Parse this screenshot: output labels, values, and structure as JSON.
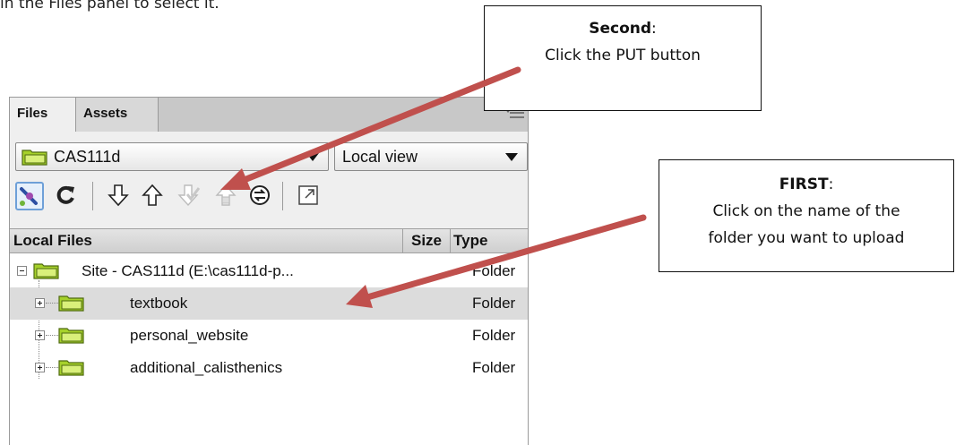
{
  "intro_text": "in the Files panel to select it.",
  "panel": {
    "tabs": [
      {
        "label": "Files",
        "active": true
      },
      {
        "label": "Assets",
        "active": false
      }
    ],
    "site_select": {
      "value": "CAS111d"
    },
    "view_select": {
      "value": "Local view"
    },
    "toolbar_icons": [
      "connect-icon",
      "refresh-icon",
      "get-icon",
      "put-icon",
      "check-out-icon",
      "check-in-icon",
      "synchronize-icon",
      "expand-icon"
    ],
    "columns": {
      "name": "Local Files",
      "size": "Size",
      "type": "Type"
    },
    "rows": [
      {
        "name": "Site - CAS111d (E:\\cas111d-p...",
        "type": "Folder"
      },
      {
        "name": "textbook",
        "type": "Folder"
      },
      {
        "name": "personal_website",
        "type": "Folder"
      },
      {
        "name": "additional_calisthenics",
        "type": "Folder"
      }
    ]
  },
  "callouts": {
    "second": {
      "title": "Second",
      "suffix": ":",
      "text": "Click the PUT button"
    },
    "first": {
      "title": "FIRST",
      "suffix": ":",
      "line1": "Click on the name of the",
      "line2": "folder you want to upload"
    }
  },
  "colors": {
    "arrow": "#c0504d",
    "folder_green": "#a6d12a",
    "connect_blue": "#6ea0d8"
  }
}
